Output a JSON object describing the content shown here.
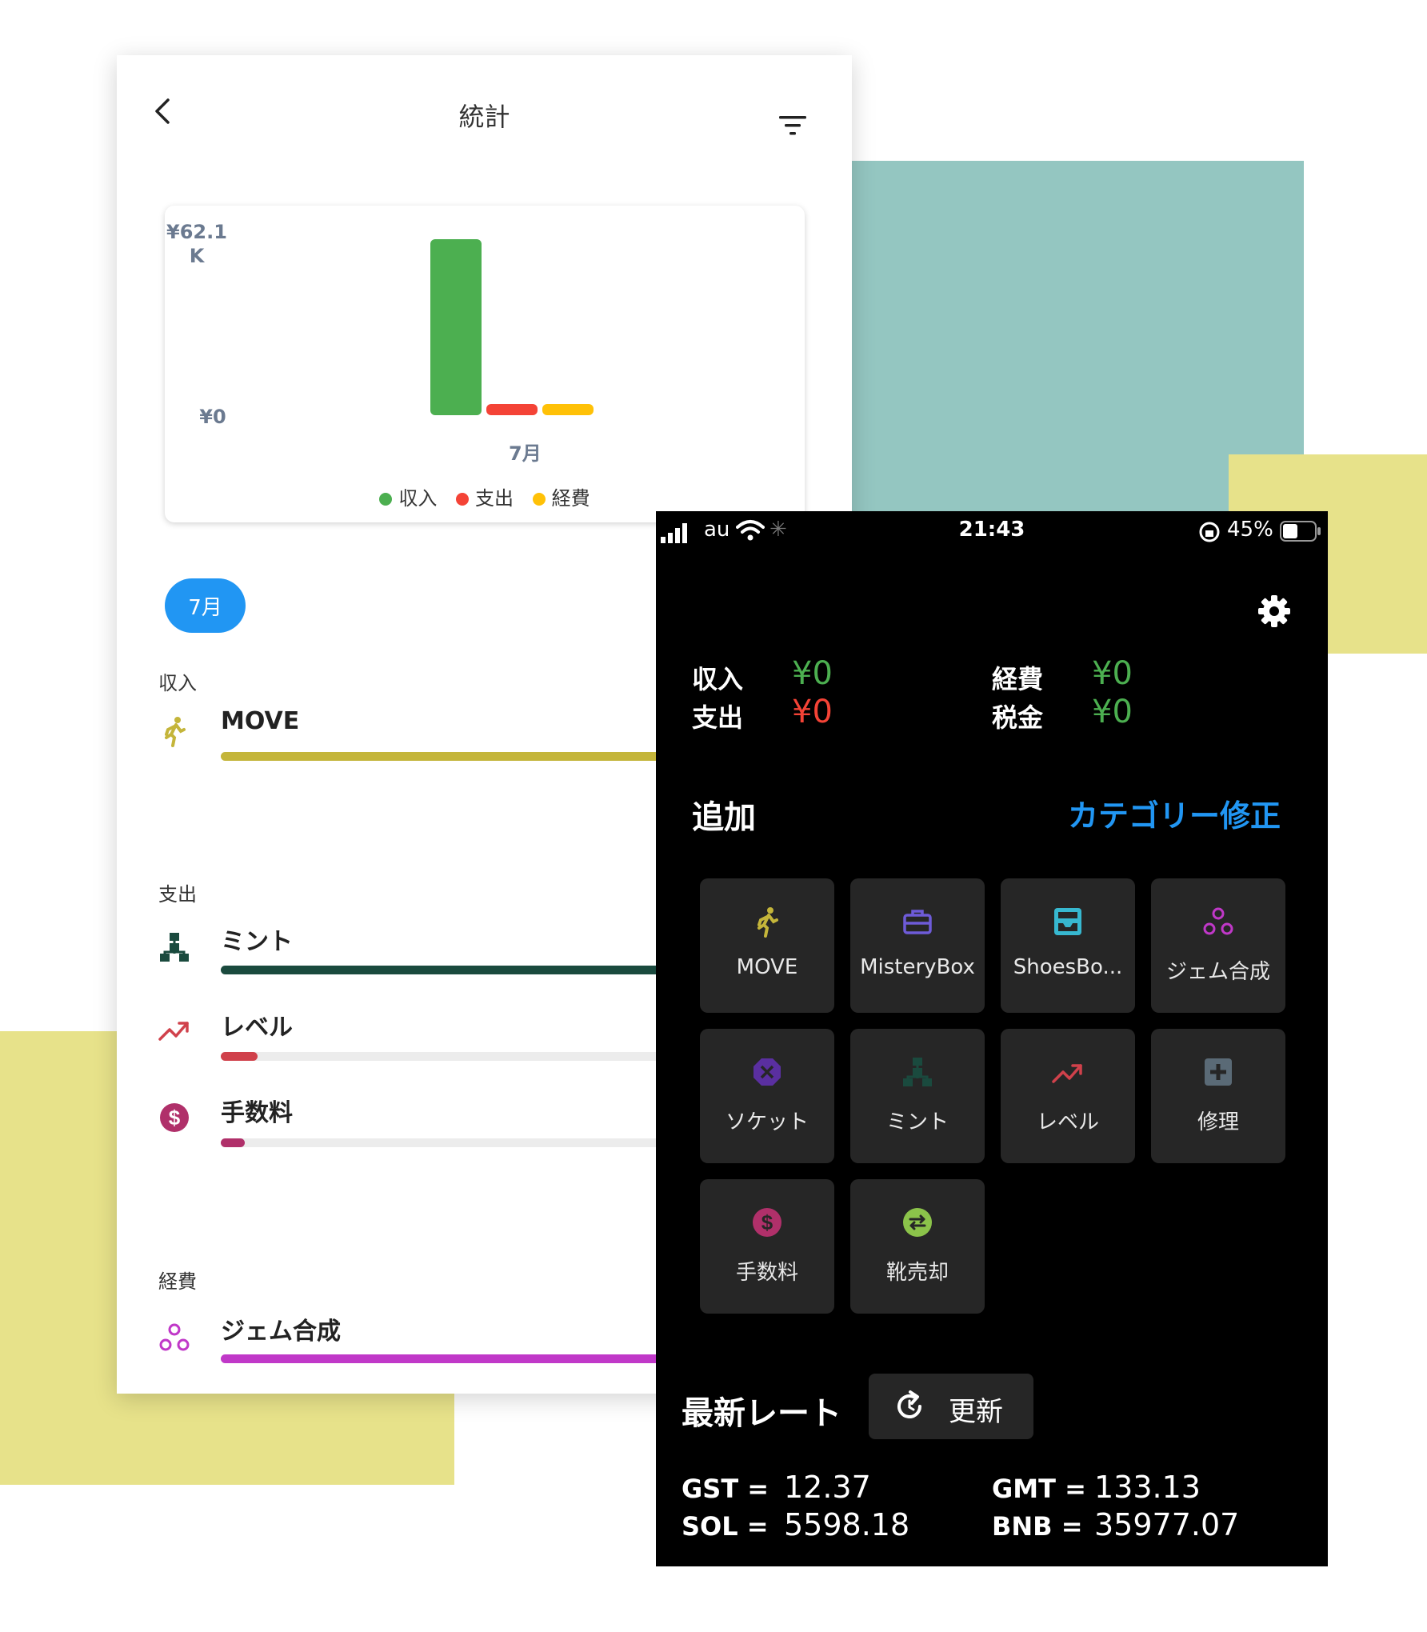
{
  "stats": {
    "title": "統計",
    "chart_data": {
      "type": "bar",
      "categories": [
        "7月"
      ],
      "series": [
        {
          "name": "収入",
          "values": [
            62100
          ],
          "color": "#4caf50"
        },
        {
          "name": "支出",
          "values": [
            0
          ],
          "color": "#f44336"
        },
        {
          "name": "経費",
          "values": [
            0
          ],
          "color": "#ffc107"
        }
      ],
      "y_ticks": [
        "¥62.1\nK",
        "¥0"
      ],
      "ylim": [
        0,
        62100
      ],
      "legend_position": "bottom"
    },
    "month_chip": "7月",
    "sections": {
      "income_label": "収入",
      "expense_label": "支出",
      "cost_label": "経費"
    },
    "categories": [
      {
        "name": "MOVE",
        "fraction": 1.0,
        "color": "#c4b53a",
        "icon": "running-icon"
      },
      {
        "name": "ミント",
        "fraction": 1.0,
        "color": "#1a4a3e",
        "icon": "hierarchy-icon"
      },
      {
        "name": "レベル",
        "fraction": 0.06,
        "color": "#d0414b",
        "icon": "trending-up-icon"
      },
      {
        "name": "手数料",
        "fraction": 0.04,
        "color": "#b0306a",
        "icon": "dollar-icon"
      },
      {
        "name": "ジェム合成",
        "fraction": 1.0,
        "color": "#c038c8",
        "icon": "webhook-icon"
      }
    ]
  },
  "phone": {
    "status": {
      "carrier": "au",
      "time": "21:43",
      "battery": "45%"
    },
    "summary": {
      "income_label": "収入",
      "income_value": "¥0",
      "expense_label": "支出",
      "expense_value": "¥0",
      "cost_label": "経費",
      "cost_value": "¥0",
      "tax_label": "税金",
      "tax_value": "¥0",
      "green": "#4caf50",
      "red": "#f44336"
    },
    "add_title": "追加",
    "category_edit": "カテゴリー修正",
    "tiles": [
      {
        "label": "MOVE",
        "icon": "running-icon",
        "color": "#c4b53a"
      },
      {
        "label": "MisteryBox",
        "icon": "toolbox-icon",
        "color": "#6e5bd8"
      },
      {
        "label": "ShoesBo...",
        "icon": "inbox-icon",
        "color": "#37b8d0"
      },
      {
        "label": "ジェム合成",
        "icon": "webhook-icon",
        "color": "#c038c8"
      },
      {
        "label": "ソケット",
        "icon": "cancel-icon",
        "color": "#5a2fa0"
      },
      {
        "label": "ミント",
        "icon": "hierarchy-icon",
        "color": "#1a4a3e"
      },
      {
        "label": "レベル",
        "icon": "trending-up-icon",
        "color": "#d0414b"
      },
      {
        "label": "修理",
        "icon": "plus-box-icon",
        "color": "#5a6a76"
      },
      {
        "label": "手数料",
        "icon": "dollar-icon",
        "color": "#b0306a"
      },
      {
        "label": "靴売却",
        "icon": "swap-icon",
        "color": "#8bc34a"
      }
    ],
    "rates_title": "最新レート",
    "refresh_label": "更新",
    "rates": [
      {
        "key": "GST =",
        "value": "12.37"
      },
      {
        "key": "GMT =",
        "value": "133.13"
      },
      {
        "key": "SOL =",
        "value": "5598.18"
      },
      {
        "key": "BNB =",
        "value": "35977.07"
      }
    ]
  }
}
